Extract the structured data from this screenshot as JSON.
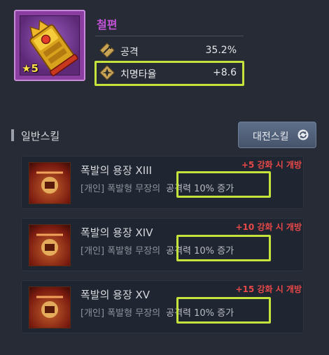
{
  "item": {
    "name": "철편",
    "star_level": "5",
    "stats": [
      {
        "label": "공격",
        "value": "35.2%"
      },
      {
        "label": "치명타율",
        "value": "+8.6"
      }
    ]
  },
  "section": {
    "title": "일반스킬",
    "tab_button": "대전스킬"
  },
  "skills": [
    {
      "name": "폭발의 용장 XIII",
      "tag": "[개인]",
      "desc": "폭발형 무장의",
      "effect": "공격력 10% 증가",
      "unlock": "+5 강화 시 개방"
    },
    {
      "name": "폭발의 용장 XIV",
      "tag": "[개인]",
      "desc": "폭발형 무장의",
      "effect": "공격력 10% 증가",
      "unlock": "+10 강화 시 개방"
    },
    {
      "name": "폭발의 용장 XV",
      "tag": "[개인]",
      "desc": "폭발형 무장의",
      "effect": "공격력 10% 증가",
      "unlock": "+15 강화 시 개방"
    }
  ],
  "colors": {
    "highlight": "#c6e33b",
    "item_name": "#c453d8",
    "unlock_text": "#e84848"
  }
}
